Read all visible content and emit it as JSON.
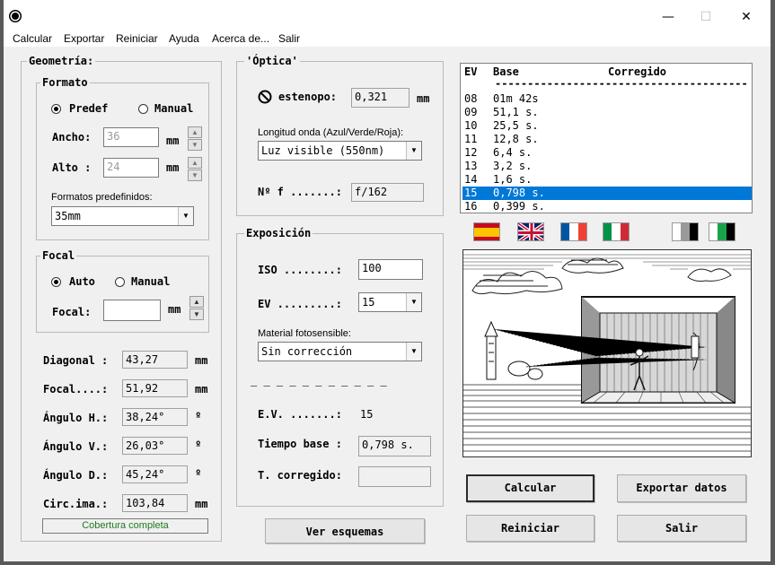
{
  "menu": [
    "Calcular",
    "Exportar",
    "Reiniciar",
    "Ayuda",
    "Acerca de...",
    "Salir"
  ],
  "window_controls": {
    "minimize": "—",
    "maximize": "☐",
    "close": "✕"
  },
  "geometria": {
    "title": "Geometría:",
    "formato": {
      "title": "Formato",
      "radio_predef": "Predef",
      "radio_manual": "Manual",
      "selected": "Predef",
      "ancho_label": "Ancho:",
      "ancho_value": "36",
      "alto_label": "Alto :",
      "alto_value": "24",
      "unit": "mm",
      "formatos_label": "Formatos predefinidos:",
      "formatos_value": "35mm"
    },
    "focal": {
      "title": "Focal",
      "radio_auto": "Auto",
      "radio_manual": "Manual",
      "selected": "Auto",
      "focal_label": "Focal:",
      "focal_value": "",
      "unit": "mm"
    },
    "results": [
      {
        "label": "Diagonal :",
        "value": "43,27",
        "unit": "mm"
      },
      {
        "label": "Focal....:",
        "value": "51,92",
        "unit": "mm"
      },
      {
        "label": "Ángulo H.:",
        "value": "38,24°",
        "unit": "º"
      },
      {
        "label": "Ángulo V.:",
        "value": "26,03°",
        "unit": "º"
      },
      {
        "label": "Ángulo D.:",
        "value": "45,24°",
        "unit": "º"
      },
      {
        "label": "Circ.ima.:",
        "value": "103,84",
        "unit": "mm"
      }
    ],
    "cobertura": "Cobertura completa"
  },
  "optica": {
    "title": "'Óptica'",
    "estenopo_label": "estenopo:",
    "estenopo_value": "0,321",
    "estenopo_unit": "mm",
    "longitud_label": "Longitud onda (Azul/Verde/Roja):",
    "longitud_value": "Luz visible (550nm)",
    "nf_label": "Nº f .......:",
    "nf_value": "f/162"
  },
  "exposicion": {
    "title": "Exposición",
    "iso_label": "ISO ........:",
    "iso_value": "100",
    "ev_label": "EV .........:",
    "ev_value": "15",
    "material_label": "Material fotosensible:",
    "material_value": "Sin corrección",
    "separator": "— — — — — — — — — — —",
    "ev_result_label": "E.V. .......:",
    "ev_result_value": "15",
    "tiempo_label": "Tiempo base :",
    "tiempo_value": "0,798 s.",
    "corregido_label": "T. corregido:",
    "corregido_value": ""
  },
  "ev_table": {
    "headers": {
      "ev": "EV",
      "base": "Base",
      "corr": "Corregido"
    },
    "rule": "--------------------------------------------",
    "rows": [
      {
        "ev": "08",
        "base": "01m 42s"
      },
      {
        "ev": "09",
        "base": "51,1 s."
      },
      {
        "ev": "10",
        "base": "25,5 s."
      },
      {
        "ev": "11",
        "base": "12,8 s."
      },
      {
        "ev": "12",
        "base": "6,4 s."
      },
      {
        "ev": "13",
        "base": "3,2 s."
      },
      {
        "ev": "14",
        "base": "1,6 s."
      },
      {
        "ev": "15",
        "base": "0,798 s."
      },
      {
        "ev": "16",
        "base": "0,399 s."
      }
    ],
    "selected_ev": "15"
  },
  "flags": [
    "spanish-flag",
    "uk-flag",
    "french-flag",
    "italian-flag",
    "grayscale-mode",
    "color-mode"
  ],
  "buttons": {
    "ver_esquemas": "Ver esquemas",
    "calcular": "Calcular",
    "exportar": "Exportar datos",
    "reiniciar": "Reiniciar",
    "salir": "Salir"
  },
  "colors": {
    "selection": "#0078d7",
    "cobertura": "#1d7a1d"
  }
}
